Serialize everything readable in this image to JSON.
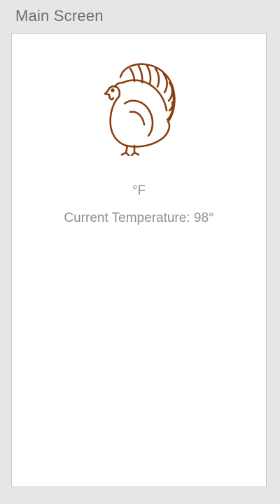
{
  "screen": {
    "title": "Main Screen"
  },
  "thermometer": {
    "icon": "turkey-icon",
    "unit": "°F",
    "current_label": "Current Temperature:",
    "current_value": "98°"
  },
  "colors": {
    "background": "#e6e6e6",
    "card": "#ffffff",
    "icon_stroke": "#8a3f12",
    "text": "#8e8e8e",
    "title_text": "#6d6d6d"
  }
}
